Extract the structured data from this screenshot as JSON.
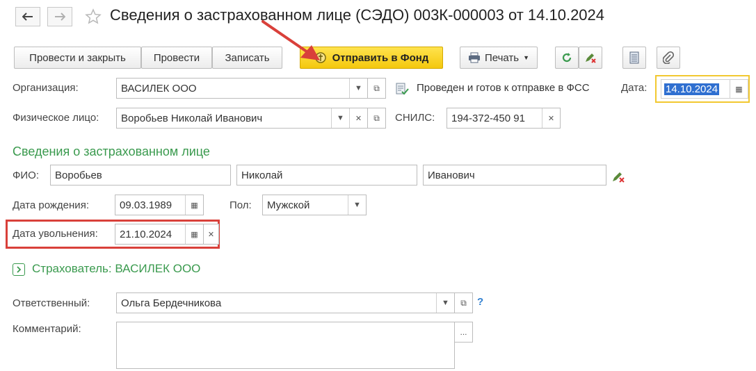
{
  "header": {
    "title": "Сведения о застрахованном лице (СЭДО) 003К-000003 от 14.10.2024"
  },
  "toolbar": {
    "post_close": "Провести и закрыть",
    "post": "Провести",
    "save": "Записать",
    "send_fund": "Отправить в Фонд",
    "print": "Печать"
  },
  "form": {
    "org_label": "Организация:",
    "org_value": "ВАСИЛЕК ООО",
    "status_text": "Проведен и готов к отправке в ФСС",
    "date_label": "Дата:",
    "date_value": "14.10.2024",
    "person_label": "Физическое лицо:",
    "person_value": "Воробьев Николай Иванович",
    "snils_label": "СНИЛС:",
    "snils_value": "194-372-450 91"
  },
  "insured": {
    "section_title": "Сведения о застрахованном лице",
    "fio_label": "ФИО:",
    "last_name": "Воробьев",
    "first_name": "Николай",
    "middle_name": "Иванович",
    "birth_label": "Дата рождения:",
    "birth_value": "09.03.1989",
    "gender_label": "Пол:",
    "gender_value": "Мужской",
    "dismissal_label": "Дата увольнения:",
    "dismissal_value": "21.10.2024"
  },
  "insurer": {
    "section_title": "Страхователь: ВАСИЛЕК ООО"
  },
  "footer": {
    "responsible_label": "Ответственный:",
    "responsible_value": "Ольга Бердечникова",
    "help_mark": "?",
    "comment_label": "Комментарий:",
    "comment_value": "",
    "comment_btn": "..."
  },
  "colors": {
    "accent_green": "#3a9a4e",
    "fund_button": "#f4c80e",
    "annotation_red": "#d9403a",
    "date_focus": "#f2c830"
  }
}
